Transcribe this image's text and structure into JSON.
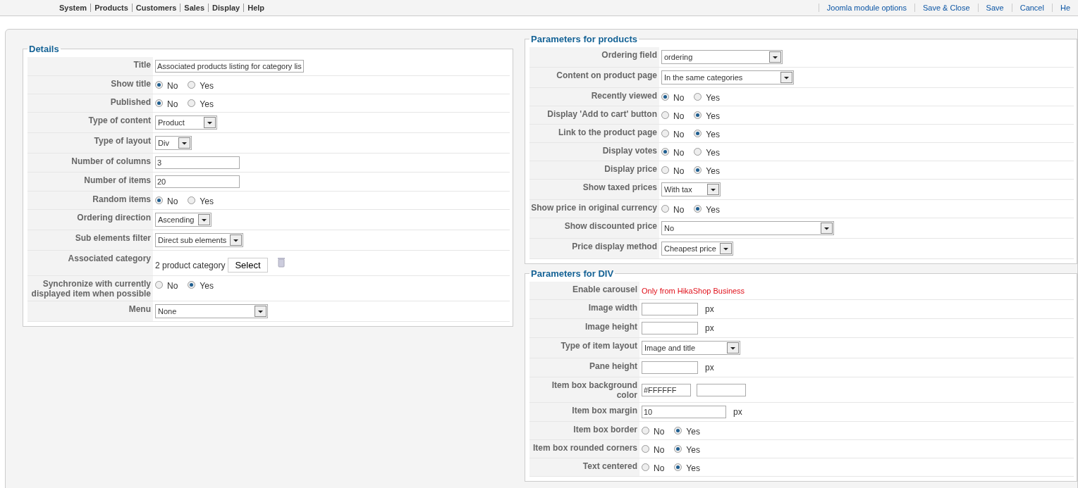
{
  "toolbar": {
    "menu": [
      "System",
      "Products",
      "Customers",
      "Sales",
      "Display",
      "Help"
    ],
    "actions": [
      "Joomla module options",
      "Save & Close",
      "Save",
      "Cancel",
      "He"
    ]
  },
  "details": {
    "title": "Details",
    "rows": [
      {
        "kind": "text",
        "label": "Title",
        "value": "Associated products listing for category lis"
      },
      {
        "kind": "radio",
        "label": "Show title",
        "options": [
          {
            "label": "No",
            "selected": true
          },
          {
            "label": "Yes",
            "selected": false
          }
        ]
      },
      {
        "kind": "radio",
        "label": "Published",
        "options": [
          {
            "label": "No",
            "selected": true
          },
          {
            "label": "Yes",
            "selected": false
          }
        ]
      },
      {
        "kind": "select",
        "label": "Type of content",
        "value": "Product"
      },
      {
        "kind": "select",
        "label": "Type of layout",
        "value": "Div"
      },
      {
        "kind": "text",
        "label": "Number of columns",
        "value": "3"
      },
      {
        "kind": "text",
        "label": "Number of items",
        "value": "20"
      },
      {
        "kind": "radio",
        "label": "Random items",
        "options": [
          {
            "label": "No",
            "selected": true
          },
          {
            "label": "Yes",
            "selected": false
          }
        ]
      },
      {
        "kind": "select",
        "label": "Ordering direction",
        "value": "Ascending"
      },
      {
        "kind": "select",
        "label": "Sub elements filter",
        "value": "Direct sub elements"
      },
      {
        "kind": "category",
        "label": "Associated category",
        "value": "2 product category",
        "button": "Select"
      },
      {
        "kind": "radio",
        "label": "Synchronize with currently displayed item when possible",
        "options": [
          {
            "label": "No",
            "selected": false
          },
          {
            "label": "Yes",
            "selected": true
          }
        ]
      },
      {
        "kind": "select",
        "label": "Menu",
        "value": "None"
      }
    ]
  },
  "products": {
    "title": "Parameters for products",
    "rows": [
      {
        "kind": "select",
        "label": "Ordering field",
        "value": "ordering"
      },
      {
        "kind": "select",
        "label": "Content on product page",
        "value": "In the same categories"
      },
      {
        "kind": "radio",
        "label": "Recently viewed",
        "options": [
          {
            "label": "No",
            "selected": true
          },
          {
            "label": "Yes",
            "selected": false
          }
        ]
      },
      {
        "kind": "radio",
        "label": "Display 'Add to cart' button",
        "options": [
          {
            "label": "No",
            "selected": false
          },
          {
            "label": "Yes",
            "selected": true
          }
        ]
      },
      {
        "kind": "radio",
        "label": "Link to the product page",
        "options": [
          {
            "label": "No",
            "selected": false
          },
          {
            "label": "Yes",
            "selected": true
          }
        ]
      },
      {
        "kind": "radio",
        "label": "Display votes",
        "options": [
          {
            "label": "No",
            "selected": true
          },
          {
            "label": "Yes",
            "selected": false
          }
        ]
      },
      {
        "kind": "radio",
        "label": "Display price",
        "options": [
          {
            "label": "No",
            "selected": false
          },
          {
            "label": "Yes",
            "selected": true
          }
        ]
      },
      {
        "kind": "select",
        "label": "Show taxed prices",
        "value": "With tax"
      },
      {
        "kind": "radio",
        "label": "Show price in original currency",
        "options": [
          {
            "label": "No",
            "selected": false
          },
          {
            "label": "Yes",
            "selected": true
          }
        ]
      },
      {
        "kind": "select",
        "label": "Show discounted price",
        "value": "No"
      },
      {
        "kind": "select",
        "label": "Price display method",
        "value": "Cheapest price"
      }
    ]
  },
  "div": {
    "title": "Parameters for DIV",
    "rows": [
      {
        "kind": "note",
        "label": "Enable carousel",
        "value": "Only from HikaShop Business"
      },
      {
        "kind": "text",
        "label": "Image width",
        "value": "",
        "unit": "px"
      },
      {
        "kind": "text",
        "label": "Image height",
        "value": "",
        "unit": "px"
      },
      {
        "kind": "select",
        "label": "Type of item layout",
        "value": "Image and title"
      },
      {
        "kind": "text",
        "label": "Pane height",
        "value": "",
        "unit": "px"
      },
      {
        "kind": "color",
        "label": "Item box background color",
        "value": "#FFFFFF"
      },
      {
        "kind": "text",
        "label": "Item box margin",
        "value": "10",
        "unit": "px"
      },
      {
        "kind": "radio",
        "label": "Item box border",
        "options": [
          {
            "label": "No",
            "selected": false
          },
          {
            "label": "Yes",
            "selected": true
          }
        ]
      },
      {
        "kind": "radio",
        "label": "Item box rounded corners",
        "options": [
          {
            "label": "No",
            "selected": false
          },
          {
            "label": "Yes",
            "selected": true
          }
        ]
      },
      {
        "kind": "radio",
        "label": "Text centered",
        "options": [
          {
            "label": "No",
            "selected": false
          },
          {
            "label": "Yes",
            "selected": true
          }
        ]
      }
    ]
  }
}
